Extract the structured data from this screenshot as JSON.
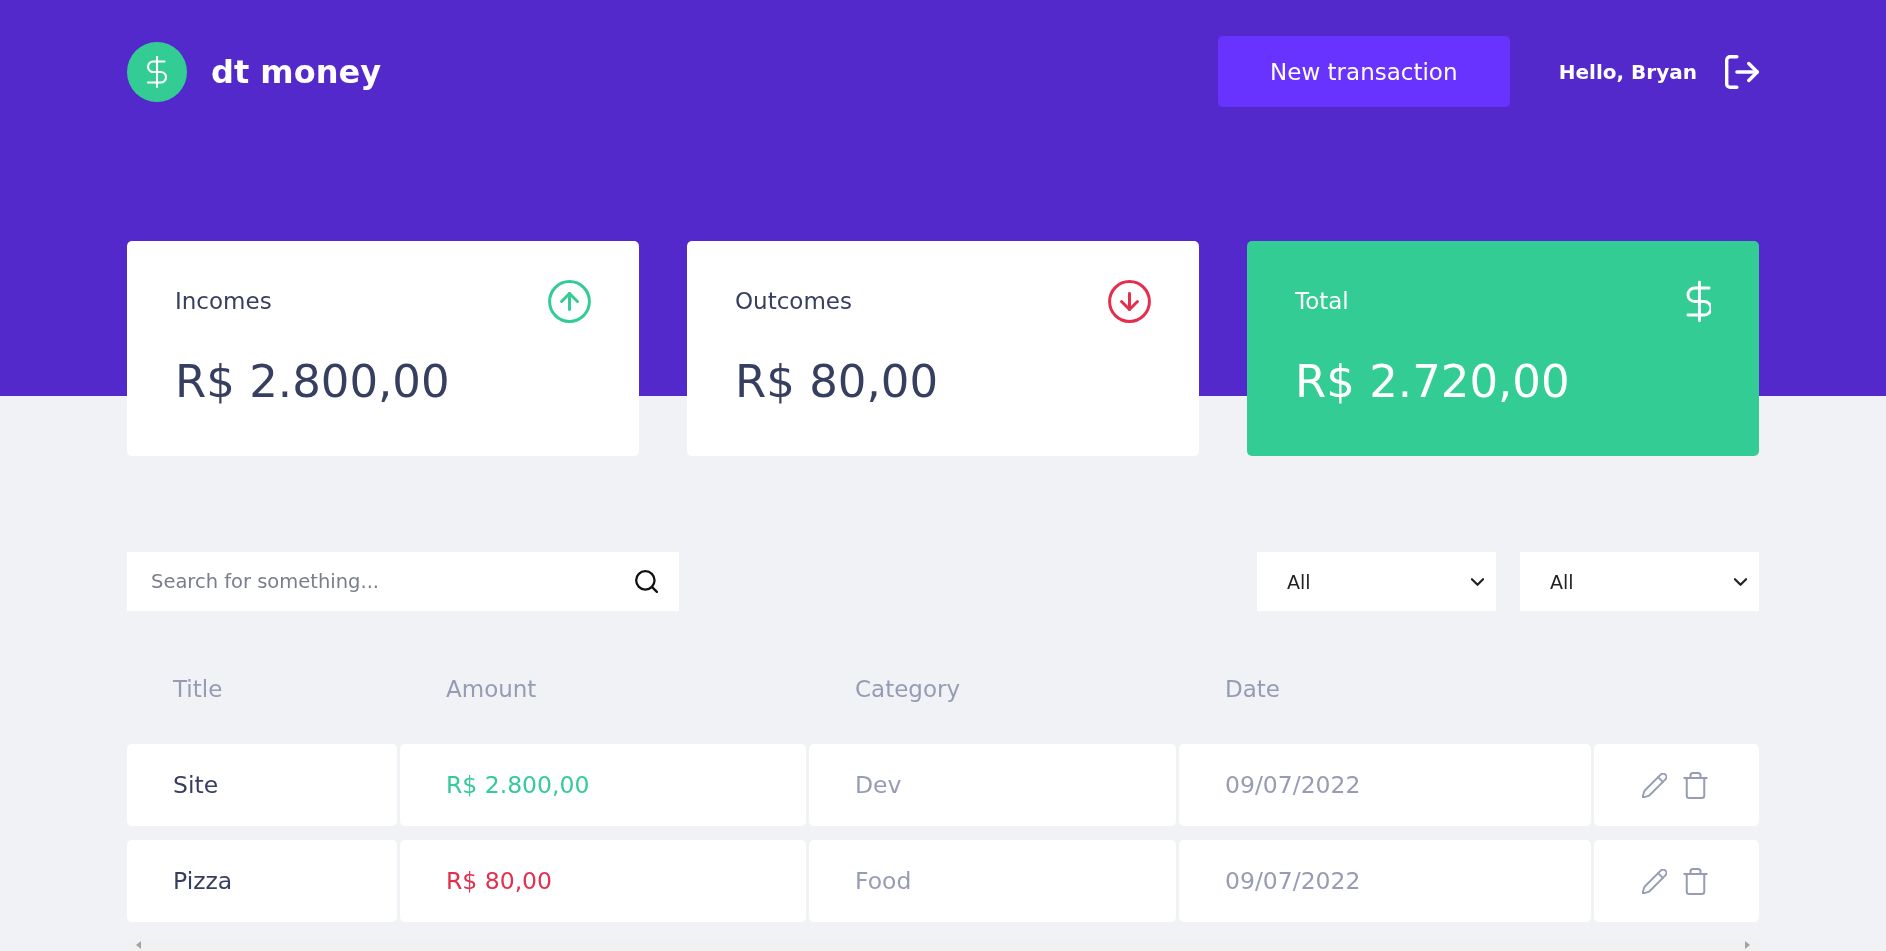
{
  "header": {
    "logo_text": "dt money",
    "new_transaction_button": "New transaction",
    "greeting": "Hello, Bryan"
  },
  "summary_cards": [
    {
      "kind": "income",
      "label": "Incomes",
      "value": "R$ 2.800,00"
    },
    {
      "kind": "outcome",
      "label": "Outcomes",
      "value": "R$ 80,00"
    },
    {
      "kind": "total",
      "label": "Total",
      "value": "R$ 2.720,00"
    }
  ],
  "filters": {
    "search": {
      "placeholder": "Search for something..."
    },
    "selects": [
      {
        "value": "All"
      },
      {
        "value": "All"
      }
    ]
  },
  "table": {
    "columns": [
      "Title",
      "Amount",
      "Category",
      "Date"
    ],
    "rows": [
      {
        "kind": "income",
        "title": "Site",
        "amount": "R$ 2.800,00",
        "category": "Dev",
        "date": "09/07/2022"
      },
      {
        "kind": "outcome",
        "title": "Pizza",
        "amount": "R$ 80,00",
        "category": "Food",
        "date": "09/07/2022"
      }
    ]
  }
}
